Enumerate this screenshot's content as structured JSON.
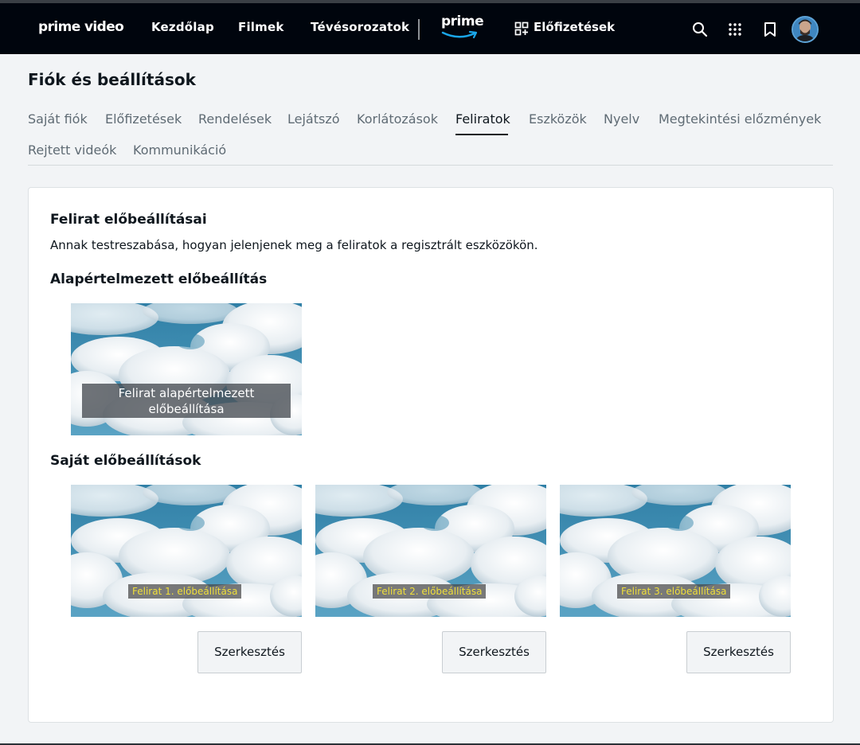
{
  "nav": {
    "logo": "prime video",
    "links": [
      "Kezdőlap",
      "Filmek",
      "Tévésorozatok"
    ],
    "prime_label": "prime",
    "subscriptions_label": "Előfizetések",
    "icons": [
      "search-icon",
      "apps-grid-icon",
      "bookmark-icon"
    ],
    "bg_color": "#00050d"
  },
  "page": {
    "title": "Fiók és beállítások",
    "tabs": [
      {
        "label": "Saját fiók",
        "active": false
      },
      {
        "label": "Előfizetések",
        "active": false
      },
      {
        "label": "Rendelések",
        "active": false
      },
      {
        "label": "Lejátszó",
        "active": false
      },
      {
        "label": "Korlátozások",
        "active": false
      },
      {
        "label": "Feliratok",
        "active": true
      },
      {
        "label": "Eszközök",
        "active": false
      },
      {
        "label": "Nyelv",
        "active": false
      },
      {
        "label": "Megtekintési előzmények",
        "active": false
      },
      {
        "label": "Rejtett videók",
        "active": false
      },
      {
        "label": "Kommunikáció",
        "active": false
      }
    ]
  },
  "card": {
    "heading": "Felirat előbeállításai",
    "description": "Annak testreszabása, hogyan jelenjenek meg a feliratok a regisztrált eszközökön.",
    "default_section": {
      "title": "Alapértelmezett előbeállítás",
      "caption_line1": "Felirat alapértelmezett",
      "caption_line2": "előbeállítása"
    },
    "custom_section": {
      "title": "Saját előbeállítások",
      "presets": [
        {
          "caption": "Felirat 1. előbeállítása",
          "button": "Szerkesztés"
        },
        {
          "caption": "Felirat 2. előbeállítása",
          "button": "Szerkesztés"
        },
        {
          "caption": "Felirat 3. előbeállítása",
          "button": "Szerkesztés"
        }
      ]
    },
    "caption_color": "#f0df3a"
  }
}
